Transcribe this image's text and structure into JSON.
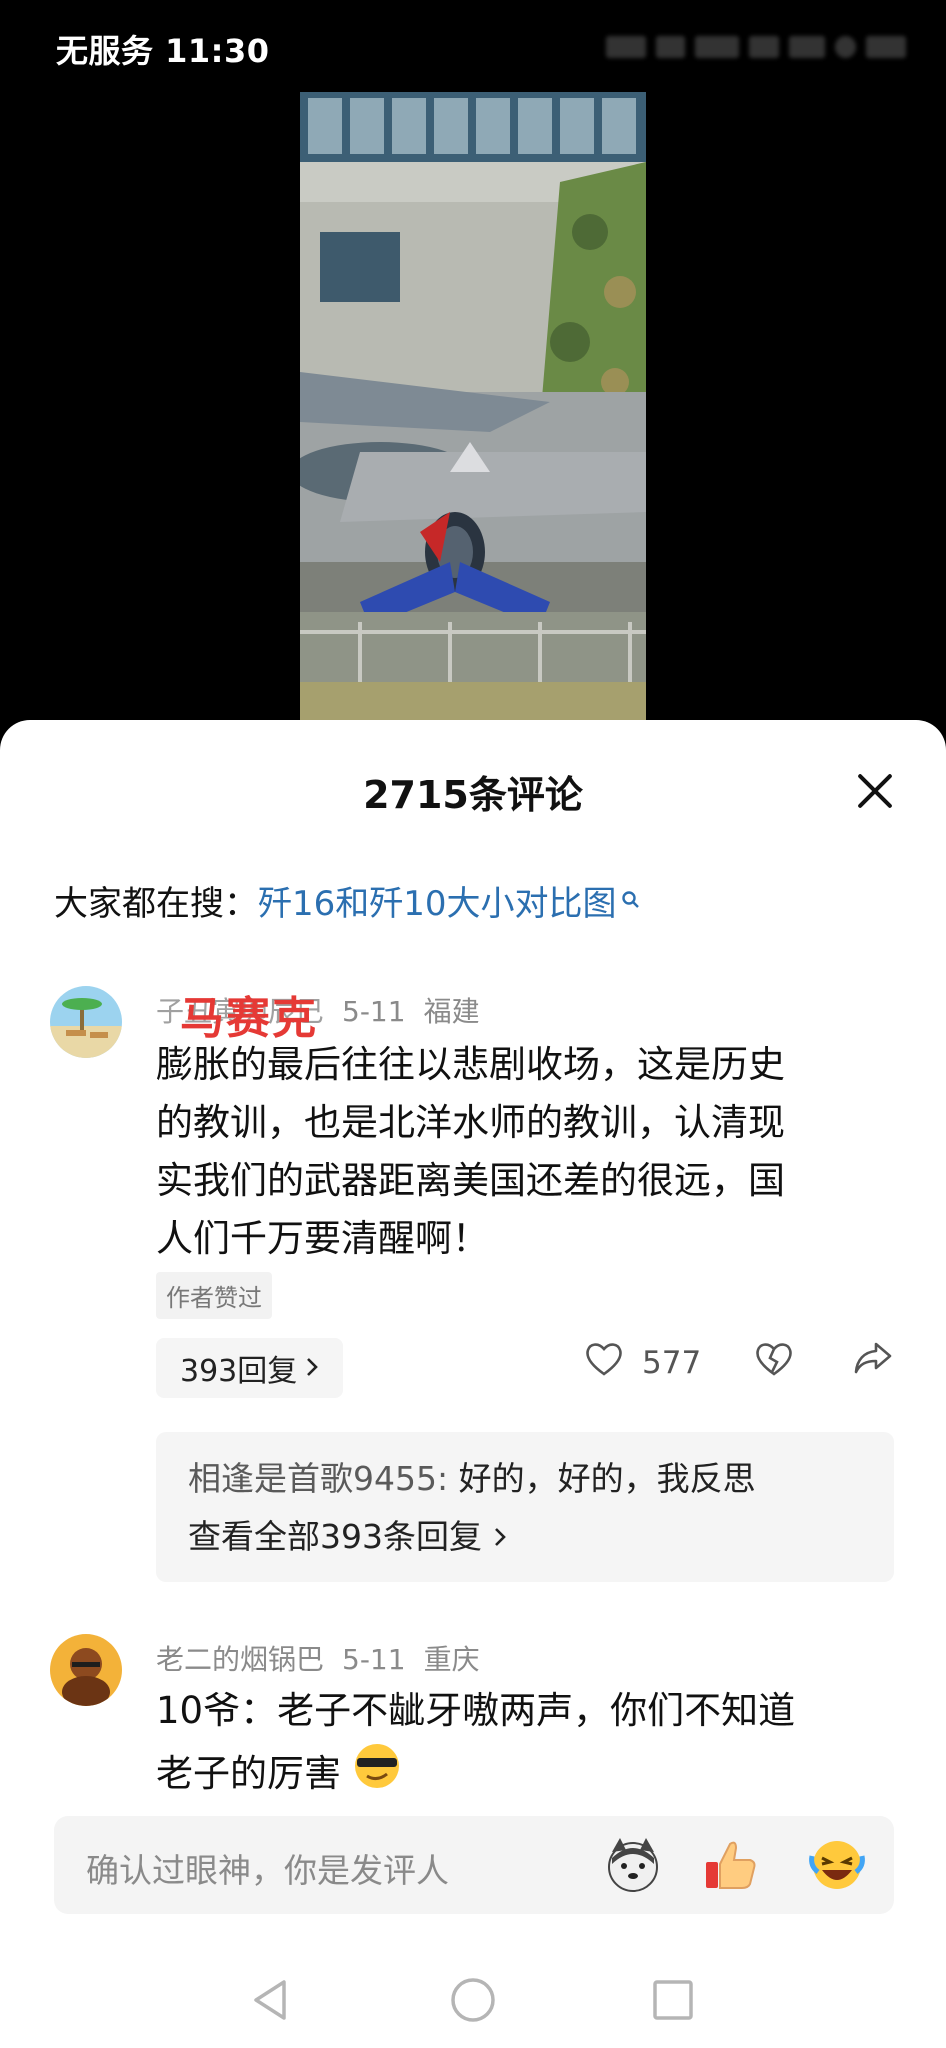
{
  "status_bar": {
    "text": "无服务 11:30"
  },
  "sheet": {
    "title": "2715条评论",
    "search_prefix": "大家都在搜：",
    "search_link": "歼16和歼10大小对比图"
  },
  "comments": [
    {
      "username": "子丑寅卯辰巳",
      "date": "5-11",
      "location": "福建",
      "watermark": "马赛克",
      "text_lines": [
        "膨胀的最后往往以悲剧收场，这是历史",
        "的教训，也是北洋水师的教训，认清现",
        "实我们的武器距离美国还差的很远，国",
        "人们千万要清醒啊！"
      ],
      "badge": "作者赞过",
      "reply_count_label": "393回复",
      "likes": "577",
      "reply_preview_user": "相逢是首歌9455:",
      "reply_preview_text": "好的，好的，我反思",
      "view_all": "查看全部393条回复"
    },
    {
      "username": "老二的烟锅巴",
      "date": "5-11",
      "location": "重庆",
      "text_lines": [
        "10爷：老子不龇牙嗷两声，你们不知道",
        "老子的厉害"
      ]
    }
  ],
  "input_bar": {
    "placeholder": "确认过眼神，你是发评人"
  },
  "icons": {
    "close": "close-icon",
    "search": "search-icon",
    "like": "heart-icon",
    "dislike": "broken-heart-icon",
    "share": "share-icon",
    "chevron": "chevron-right-icon",
    "emoji1": "husky-emoji-icon",
    "emoji2": "thumbs-up-emoji-icon",
    "emoji3": "laughing-emoji-icon",
    "nav_back": "back-triangle-icon",
    "nav_home": "home-circle-icon",
    "nav_recent": "recent-square-icon"
  },
  "colors": {
    "link": "#2b6fb0",
    "watermark": "#e53935"
  }
}
